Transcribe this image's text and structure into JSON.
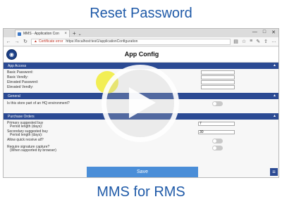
{
  "video": {
    "title": "Reset Password",
    "caption": "MMS for RMS"
  },
  "browser": {
    "tab_title": "MMS - Application Con",
    "tab_close": "×",
    "new_tab": "+",
    "cert_warning": "Certificate error",
    "url": "https://localhost:test1/applicationConfiguration",
    "window_controls": [
      "—",
      "□",
      "✕"
    ]
  },
  "app": {
    "title": "App Config",
    "sections": {
      "app_access": {
        "title": "App Access",
        "fields": [
          {
            "label": "Basic Password:",
            "value": ""
          },
          {
            "label": "Basic Vendly:",
            "value": ""
          },
          {
            "label": "Elevated Password:",
            "value": ""
          },
          {
            "label": "Elevated Vendly:",
            "value": ""
          }
        ]
      },
      "general": {
        "title": "General",
        "fields": [
          {
            "label": "Is this store part of an HQ environment?",
            "toggle": false
          }
        ]
      },
      "purchase_orders": {
        "title": "Purchase Orders",
        "fields": [
          {
            "label": "Primary suggested buy",
            "sub": "Period length (days):",
            "value": "7"
          },
          {
            "label": "Secondary suggested buy",
            "sub": "Period length (days):",
            "value": "30"
          },
          {
            "label": "Allow quick receive all?",
            "toggle": false
          },
          {
            "label": "Require signature capture?",
            "sub": "(When supported by browser)",
            "toggle": false
          }
        ]
      }
    },
    "save_label": "Save"
  },
  "icons": {
    "back": "back-arrow-icon",
    "forward": "forward-arrow-icon",
    "refresh": "refresh-icon",
    "play": "play-icon",
    "menu": "hamburger-menu-icon"
  },
  "colors": {
    "accent": "#2b4a93",
    "title_blue": "#1f5aa8",
    "save": "#4a8ed8"
  }
}
